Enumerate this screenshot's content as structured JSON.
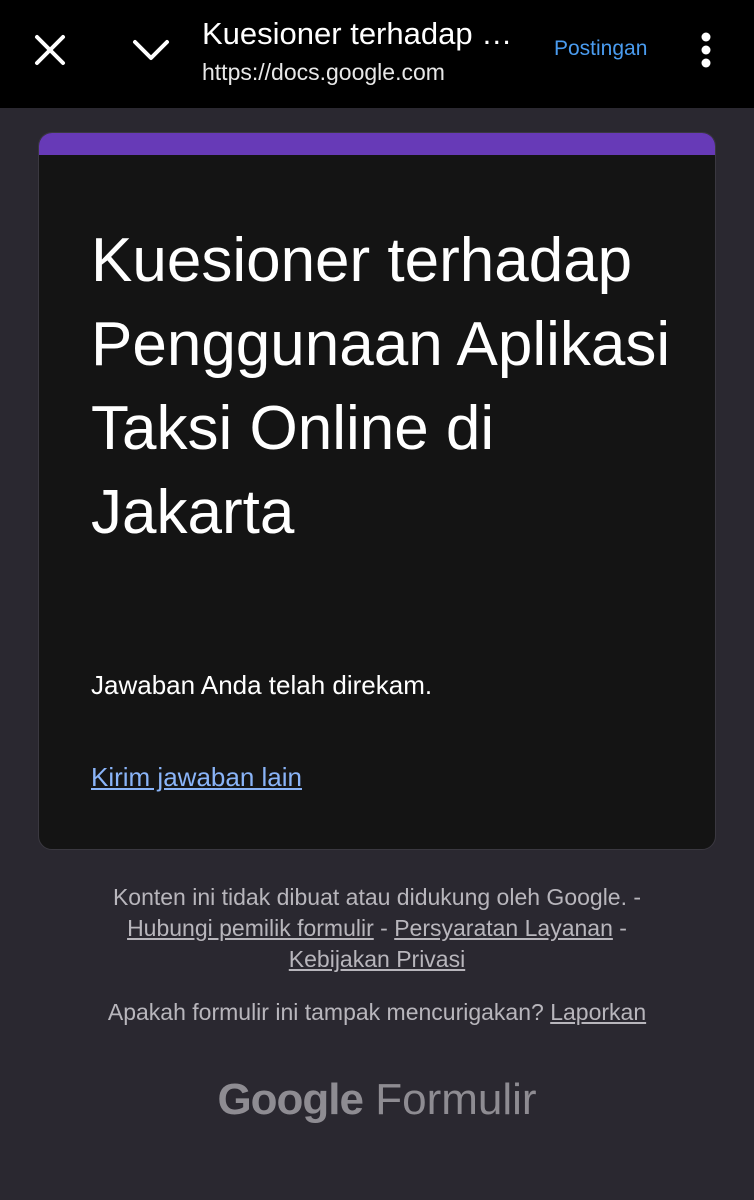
{
  "topbar": {
    "title": "Kuesioner terhadap Penggunaan Aplikasi Taksi Online di Jakarta",
    "url": "https://docs.google.com",
    "post_label": "Postingan",
    "icons": [
      "close-icon",
      "chevron-down-icon",
      "more-vert-icon"
    ]
  },
  "form": {
    "title": "Kuesioner terhadap Penggunaan Aplikasi Taksi Online di Jakarta",
    "confirmation": "Jawaban Anda telah direkam.",
    "resubmit_link": "Kirim jawaban lain",
    "accent_color": "#673ab7"
  },
  "footer": {
    "disclaimer": "Konten ini tidak dibuat atau didukung oleh Google. -",
    "contact_owner": "Hubungi pemilik formulir",
    "terms": "Persyaratan Layanan",
    "privacy": "Kebijakan Privasi",
    "separator": " - ",
    "report_question": "Apakah formulir ini tampak mencurigakan?",
    "report_link": "Laporkan",
    "brand_google": "Google",
    "brand_product": "Formulir"
  }
}
